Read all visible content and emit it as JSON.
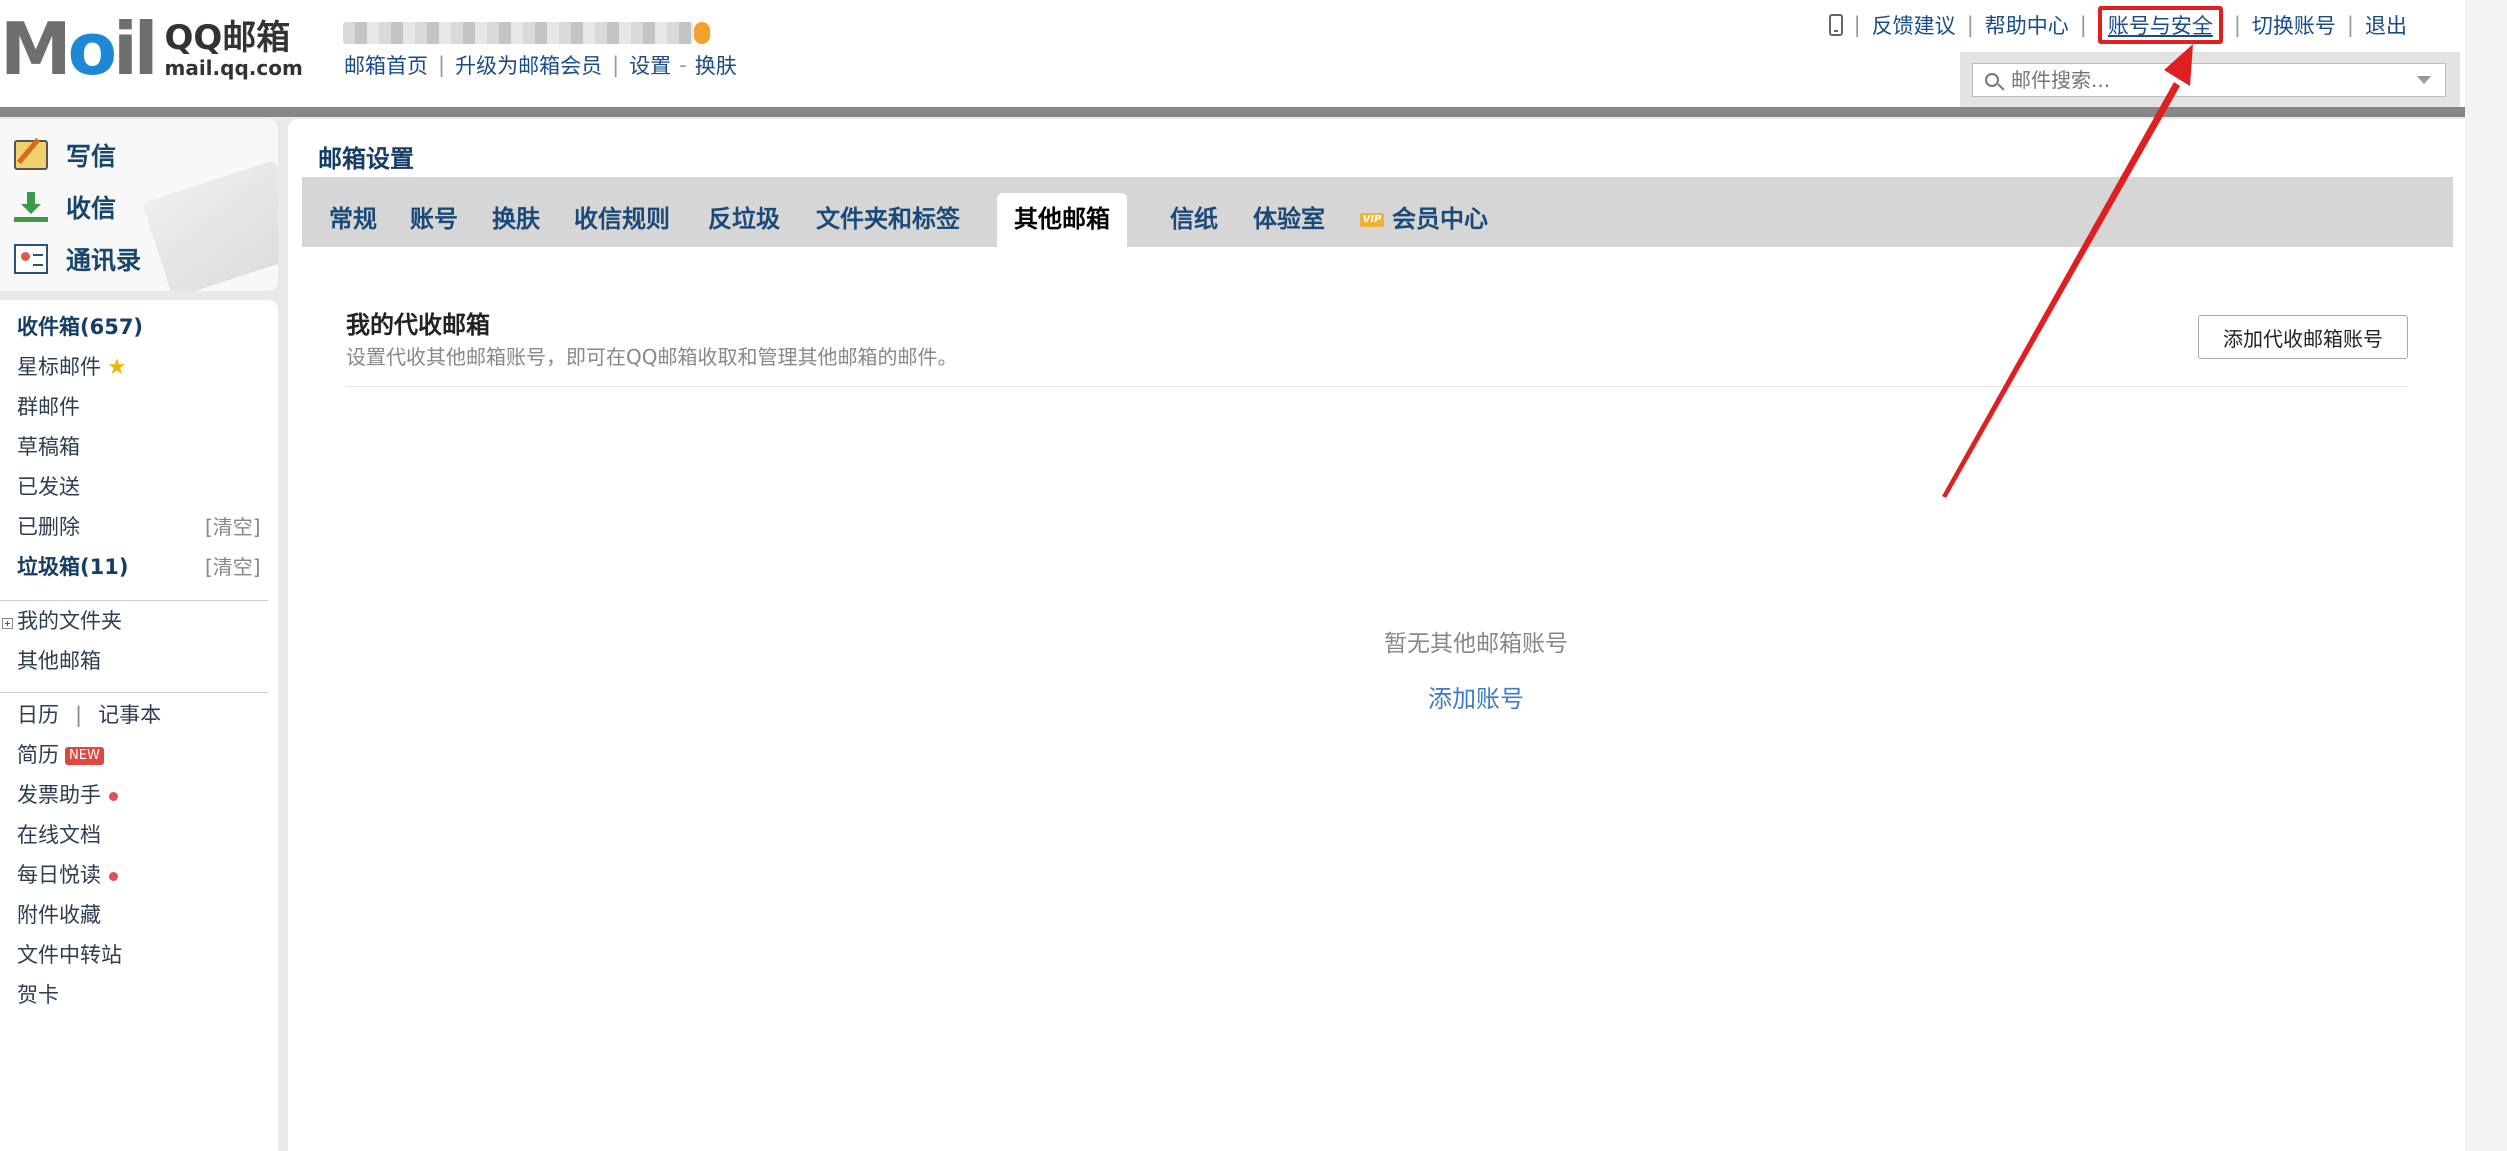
{
  "header": {
    "logo_name": "QQ邮箱",
    "logo_domain": "mail.qq.com",
    "links": [
      "邮箱首页",
      "升级为邮箱会员",
      "设置",
      "换肤"
    ],
    "top_links": [
      "反馈建议",
      "帮助中心",
      "账号与安全",
      "切换账号",
      "退出"
    ],
    "search_placeholder": "邮件搜索..."
  },
  "sidebar": {
    "compose": [
      {
        "label": "写信",
        "icon": "write-icon"
      },
      {
        "label": "收信",
        "icon": "inbox-icon"
      },
      {
        "label": "通讯录",
        "icon": "contacts-icon"
      }
    ],
    "inbox": "收件箱(657)",
    "starred": "星标邮件",
    "group": "群邮件",
    "drafts": "草稿箱",
    "sent": "已发送",
    "deleted": "已删除",
    "spam": "垃圾箱(11)",
    "clear_label": "[清空]",
    "my_folders": "我的文件夹",
    "other_mailbox": "其他邮箱",
    "calendar": "日历",
    "notes": "记事本",
    "resume": "简历",
    "new_badge": "NEW",
    "invoice": "发票助手",
    "docs": "在线文档",
    "daily_read": "每日悦读",
    "attachments": "附件收藏",
    "file_transfer": "文件中转站",
    "cards": "贺卡"
  },
  "main": {
    "title": "邮箱设置",
    "tabs": [
      "常规",
      "账号",
      "换肤",
      "收信规则",
      "反垃圾",
      "文件夹和标签",
      "其他邮箱",
      "信纸",
      "体验室",
      "会员中心"
    ],
    "active_tab": "其他邮箱",
    "vip_badge": "VIP",
    "section_title": "我的代收邮箱",
    "section_desc": "设置代收其他邮箱账号，即可在QQ邮箱收取和管理其他邮箱的邮件。",
    "add_proxy_button": "添加代收邮箱账号",
    "empty_text": "暂无其他邮箱账号",
    "add_account_link": "添加账号"
  },
  "colors": {
    "accent": "#1b4b88",
    "highlight": "#e02020",
    "link": "#3b7ec3"
  }
}
